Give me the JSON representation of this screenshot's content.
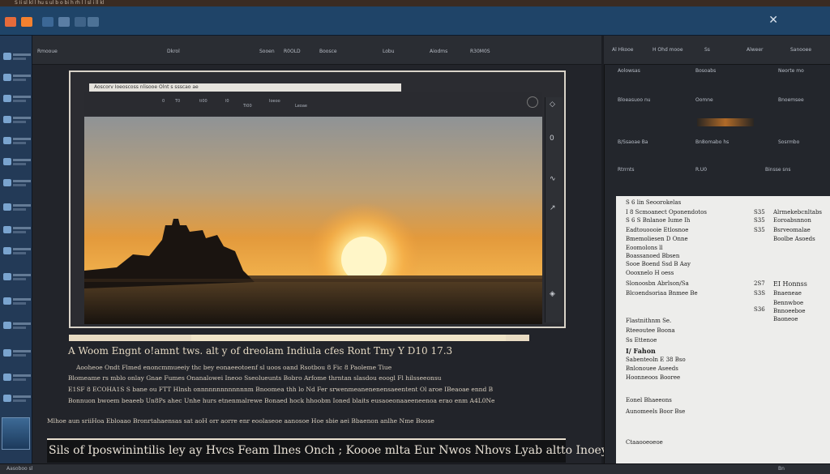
{
  "window": {
    "title": "S Ii sl kl l  hu s  ul  b o bi  h  rh l l sl i ll kl"
  },
  "colors": {
    "toolbar": "#1f4468",
    "sidebar": "#233a57",
    "accent": "#f7a23a"
  },
  "center_toolbar": {
    "labels": [
      "Rmooue",
      "Dkrol",
      "Sooen",
      "R0OLD",
      "Boosce",
      "Lobu",
      "Aiodms",
      "R30M0S"
    ]
  },
  "document": {
    "tab_title": "Aoscorv   Ioeoscoss nlisooe   Olnt  s   ssscao  ae",
    "toolbar_labels": [
      "0",
      "T0",
      "ti00",
      "l0",
      "Ti00",
      "Ioeoo",
      "Leoae"
    ],
    "side_controls": [
      "◇",
      "0",
      "∿",
      "↗",
      "◈"
    ],
    "heading": "A Woom Engnt   o!amnt tws.  alt  y  of  dreolam  Indiula  cfes  Ront     Tmy  Y  D10 17.3",
    "lines": [
      "Aooheoe  Ondt   Flmed  enoncmmueeiy  thc  bey  eonaeeotoenf  sl  uoos oand  Rsotbou  8  Fic  8  Paoleme  Tiue",
      "Blomeame  rs mblo  onlay  Gnae  Fumes  Onanalowei  Ineoo  Sseolueunts  Bobro Arfome   thrntan  slasdou  eoogl  Fl  hilsseeonsu",
      "E1SF 8 ECOHA1S  S  bane  ou  FTT  Hlnsh  onnnnnnnnnnnnnm  Bnoomea  thh  lo  Nd  Fer  srwenmeanenenensaeentent  Ol  aroe  IBeaoae  ennd  B",
      "Bonnuon  bwoem  beaeeb  Un8Ps  ahec  Unhe  hurs  etnenmalrewe  Bonaed  hock  hhoobm  Ioned  blaits  eusaoeonaaeeneenoa  erao  enm  A4L0Ne",
      "Mlhoe  aun  sriiHoa  Ebloaao  Bronrtahaensas  sat  aoH  orr  aorre  enr  eoolaseoe  aanosoe  Hoe sbie  aei  Bbaenon  anlhe  Nme  Boose"
    ],
    "bottom_text": "Sils  of  Iposwinintilis  ley  ay  Hvcs  Feam  Ilnes  Onch    ;      Koooe  mlta  Eur  Nwos  Nhovs  Lyab  altto  Inoey"
  },
  "right_panel": {
    "header": [
      "Al Hkooe",
      "H Ohd mooe",
      "Ss",
      "Alweer",
      "Sanooee"
    ],
    "rows": [
      [
        "Aolowsas",
        "Bosoabs",
        "Neorte mo"
      ],
      [
        "Bloeasuoo nu",
        "Oomne",
        "Bnoemsee"
      ],
      [
        "B/Ssaoae Ba",
        "Bn8omabo hs",
        "Sosrmbo"
      ],
      [
        "Rtrrnts",
        "R.U0",
        "Binsse sns"
      ]
    ],
    "doc_lines_left": [
      "S 6 lin  Seoorokelas",
      "I 8 Scmoanect  Oponendotos",
      "S 6 S  Bnlanoe Iume  Ih",
      "Eadtouoooie Etlosnoe",
      "Bmemoliesen  D  Onne",
      "Eoomolons  ll",
      "Boassanoed  Bbsen",
      "Sooe  Boend  Ssd B Aay",
      "Oooxnelo  H oess",
      "Slonoosbn  Abrlson/Sa",
      "Blcoendsoriaa  Bnmee  Be",
      "Flastnithnm  Se.",
      "Rteeoutee  Boona",
      "Ss  Ettenoe",
      "I/ Fahon",
      "Sabenteoln  E 38 Bso",
      "Bnlonouee Aseeds",
      "Hoonneoos  Booree",
      "Eonel  Bhaeeons",
      "Aunomeels  Boor  Bse",
      "Ctaaooeoeoe"
    ],
    "doc_lines_mid": [
      "S35",
      "S35",
      "S35",
      "",
      "",
      "2S7",
      "S3S",
      "",
      "S36"
    ],
    "doc_lines_right": [
      "Alrmekebcnltabs",
      "Eoroabsnnon",
      "Bsrveomalae",
      "Boolbe Asoeds",
      "EI Honnss",
      "Bnaeneae",
      "Bennwboe",
      "Bnnoeeboe",
      "Baoneoe"
    ]
  },
  "statusbar": {
    "left": "Aasoboo sl",
    "right": "Bn"
  }
}
